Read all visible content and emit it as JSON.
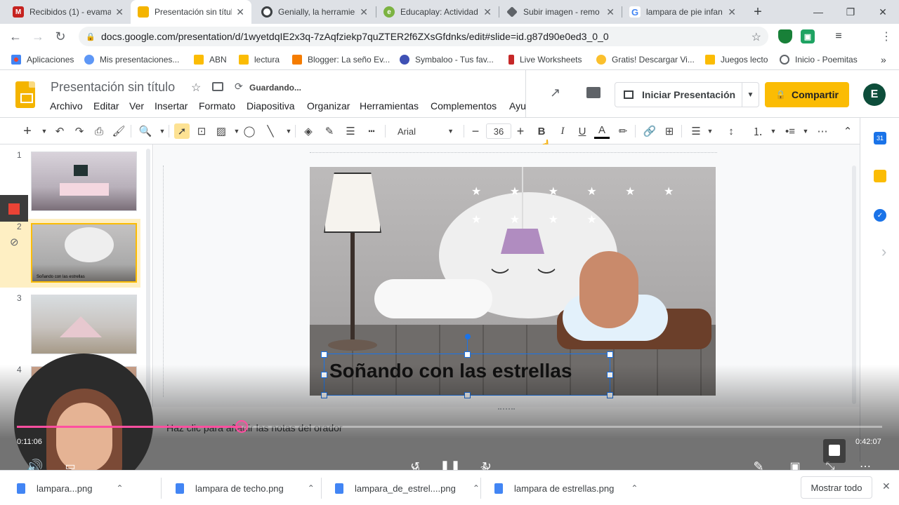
{
  "tabs": [
    {
      "title": "Recibidos (1) - evama",
      "color": "#c5221f",
      "icon": "gmail-icon"
    },
    {
      "title": "Presentación sin títul",
      "color": "#f4b400",
      "icon": "slides-icon"
    },
    {
      "title": "Genially, la herramien",
      "color": "#3c4043",
      "icon": "chrome-icon"
    },
    {
      "title": "Educaplay: Actividad",
      "color": "#7cb342",
      "icon": "educaplay-icon"
    },
    {
      "title": "Subir imagen - remo",
      "color": "#5f6368",
      "icon": "remove-bg-icon"
    },
    {
      "title": "lampara de pie infan",
      "color": "#4285f4",
      "icon": "google-icon"
    }
  ],
  "address": {
    "url": "docs.google.com/presentation/d/1wyetdqIE2x3q-7zAqfziekp7quZTER2f6ZXsGfdnks/edit#slide=id.g87d90e0ed3_0_0"
  },
  "profile": {
    "initial": "E"
  },
  "bookmarks": [
    {
      "label": "Aplicaciones",
      "color": "#4285f4"
    },
    {
      "label": "Mis presentaciones...",
      "color": "#5e97f6"
    },
    {
      "label": "ABN",
      "color": "#fbbc04"
    },
    {
      "label": "lectura",
      "color": "#fbbc04"
    },
    {
      "label": "Blogger: La seño Ev...",
      "color": "#f57c00"
    },
    {
      "label": "Symbaloo - Tus fav...",
      "color": "#3f51b5"
    },
    {
      "label": "Live Worksheets",
      "color": "#c62828"
    },
    {
      "label": "Gratis! Descargar Vi...",
      "color": "#fbc02d"
    },
    {
      "label": "Juegos lecto",
      "color": "#fbbc04"
    },
    {
      "label": "Inicio - Poemitas",
      "color": "#5f6368"
    }
  ],
  "slides": {
    "title": "Presentación sin título",
    "saving": "Guardando...",
    "menu": [
      "Archivo",
      "Editar",
      "Ver",
      "Insertar",
      "Formato",
      "Diapositiva",
      "Organizar",
      "Herramientas",
      "Complementos",
      "Ayu"
    ],
    "present": "Iniciar Presentación",
    "share": "Compartir",
    "font": "Arial",
    "fontSize": "36",
    "slideText": "Soñando con las estrellas",
    "thumbCaption": "Soñando con las estrellas",
    "speakerNotes": "Haz clic para añadir las notas del orador",
    "slideNumbers": [
      "1",
      "2",
      "3",
      "4"
    ]
  },
  "video": {
    "elapsed": "0:11:06",
    "total": "0:42:07",
    "rewind": "10",
    "forward": "30",
    "progress": 0.26
  },
  "downloads": {
    "items": [
      "lampara...png",
      "lampara de techo.png",
      "lampara_de_estrel....png",
      "lampara de estrellas.png"
    ],
    "showAll": "Mostrar todo"
  }
}
